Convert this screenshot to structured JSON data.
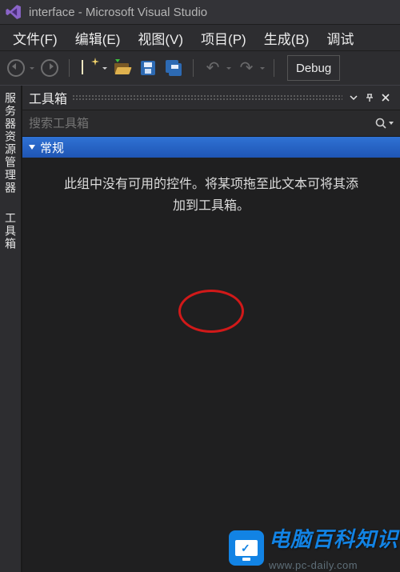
{
  "window": {
    "title": "interface - Microsoft Visual Studio"
  },
  "menu": {
    "file": "文件(F)",
    "edit": "编辑(E)",
    "view": "视图(V)",
    "project": "项目(P)",
    "build": "生成(B)",
    "debug": "调试"
  },
  "toolbar": {
    "debug_label": "Debug"
  },
  "siderail": {
    "server_explorer": "服务器资源管理器",
    "toolbox": "工具箱"
  },
  "panel": {
    "title": "工具箱",
    "search_placeholder": "搜索工具箱",
    "category": "常规",
    "empty_line1": "此组中没有可用的控件。将某项拖至此文本可将其添",
    "empty_line2": "加到工具箱。"
  },
  "watermark": {
    "brand": "电脑百科知识",
    "url": "www.pc-daily.com"
  }
}
